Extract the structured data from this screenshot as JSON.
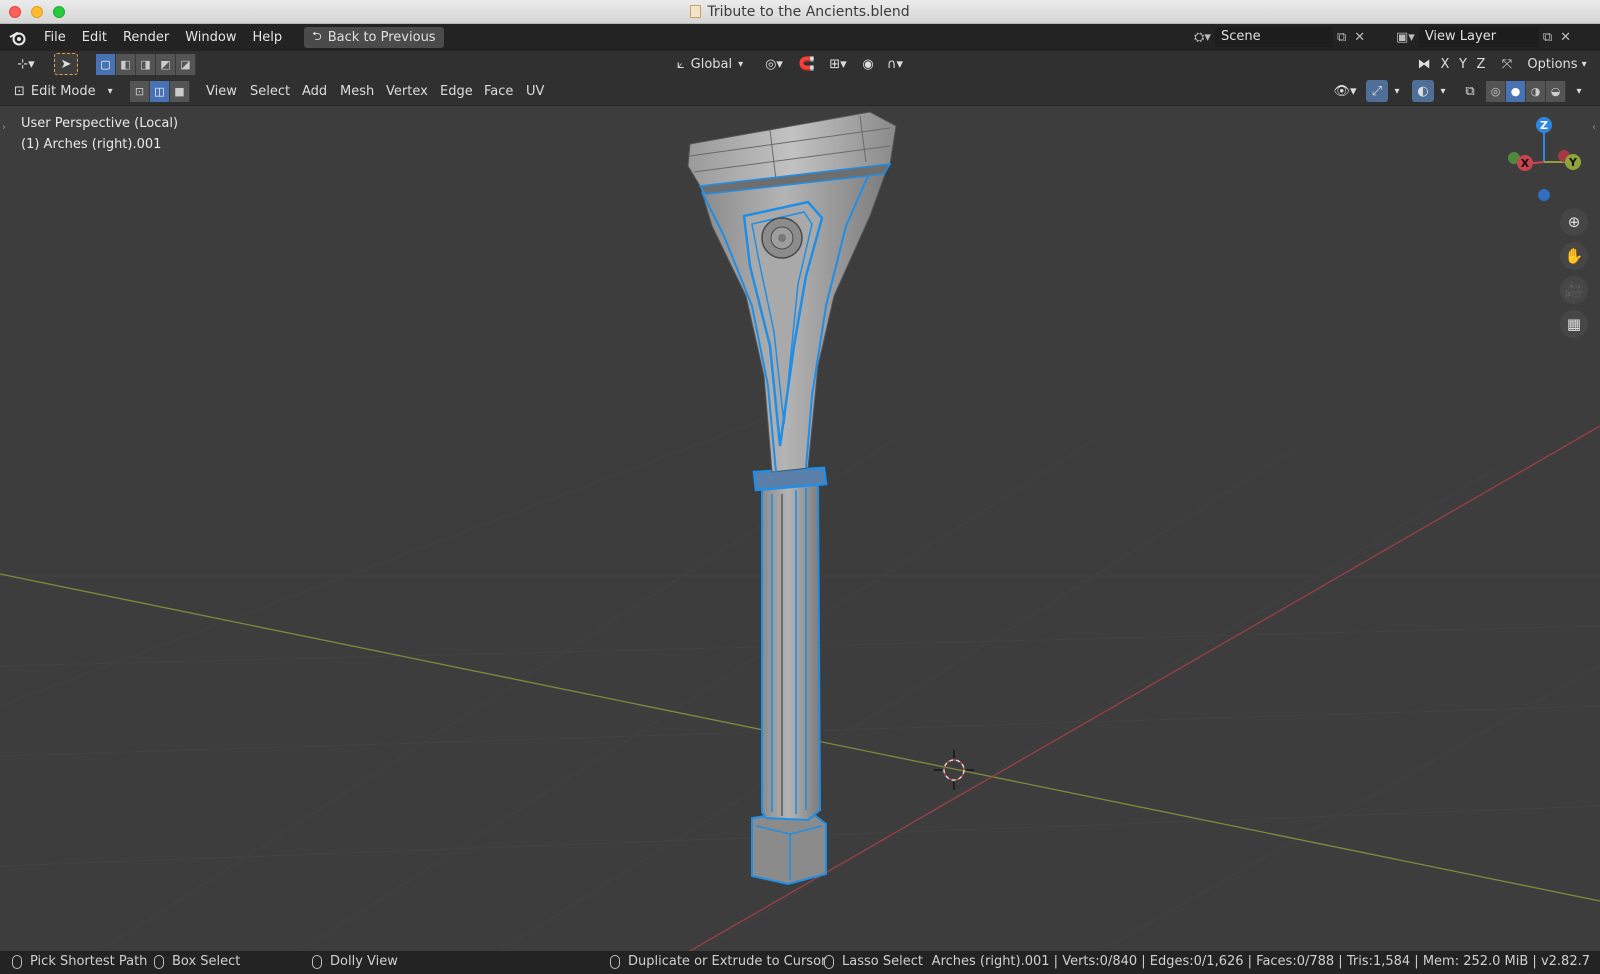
{
  "window": {
    "title": "Tribute to the Ancients.blend"
  },
  "menu": {
    "items": [
      "File",
      "Edit",
      "Render",
      "Window",
      "Help"
    ],
    "back_button": "Back to Previous",
    "scene_label": "Scene",
    "view_layer_label": "View Layer"
  },
  "toolbar": {
    "transform_orientation": "Global",
    "axis_x": "X",
    "axis_y": "Y",
    "axis_z": "Z",
    "options_label": "Options"
  },
  "editor_header": {
    "mode": "Edit Mode",
    "menus": [
      "View",
      "Select",
      "Add",
      "Mesh",
      "Vertex",
      "Edge",
      "Face",
      "UV"
    ],
    "select_mode_active": "edge"
  },
  "viewport": {
    "perspective_label": "User Perspective (Local)",
    "object_label": "(1) Arches (right).001",
    "gizmo": {
      "x": "X",
      "y": "Y",
      "z": "Z"
    },
    "colors": {
      "background": "#3d3d3d",
      "selection": "#1f8ee6",
      "x_axis": "#c8444f",
      "y_axis": "#8ea43a",
      "z_axis": "#2f86e0"
    }
  },
  "statusbar": {
    "hints": [
      {
        "icon": "mouse-left-icon",
        "label": "Pick Shortest Path"
      },
      {
        "icon": "mouse-middle-icon",
        "label": "Box Select"
      },
      {
        "icon": "mouse-right-icon",
        "label": "Dolly View"
      },
      {
        "icon": "mouse-left-icon",
        "label": "Duplicate or Extrude to Cursor"
      },
      {
        "icon": "mouse-middle-icon",
        "label": "Lasso Select"
      }
    ],
    "stats": "Arches (right).001 | Verts:0/840 | Edges:0/1,626 | Faces:0/788 | Tris:1,584 | Mem: 252.0 MiB | v2.82.7"
  }
}
